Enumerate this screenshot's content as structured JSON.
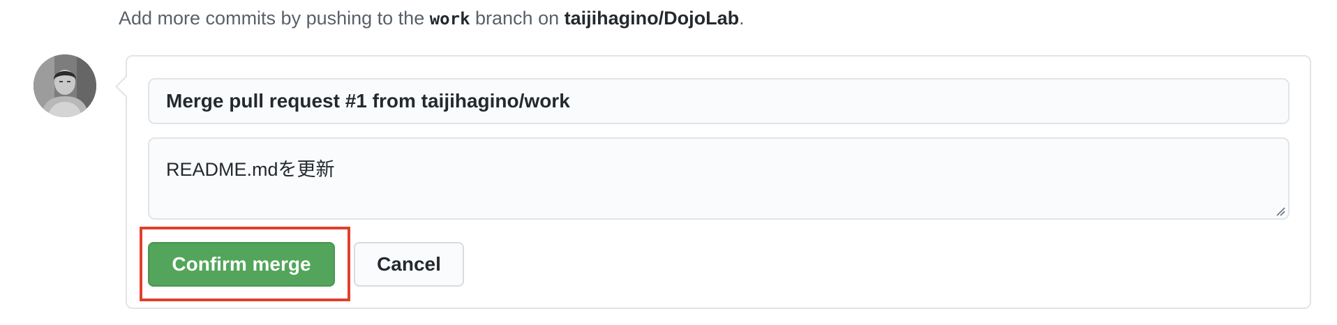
{
  "hint": {
    "prefix": "Add more commits by pushing to the ",
    "branch": "work",
    "middle": " branch on ",
    "repo": "taijihagino/DojoLab",
    "suffix": "."
  },
  "merge_form": {
    "commit_title": "Merge pull request #1 from taijihagino/work",
    "commit_message": "README.mdを更新",
    "confirm_label": "Confirm merge",
    "cancel_label": "Cancel"
  },
  "colors": {
    "confirm_button": "#52a55a",
    "highlight_border": "#e0412c"
  },
  "icons": {
    "avatar": "user-avatar-photo",
    "resize": "textarea-resize-grip-icon"
  }
}
